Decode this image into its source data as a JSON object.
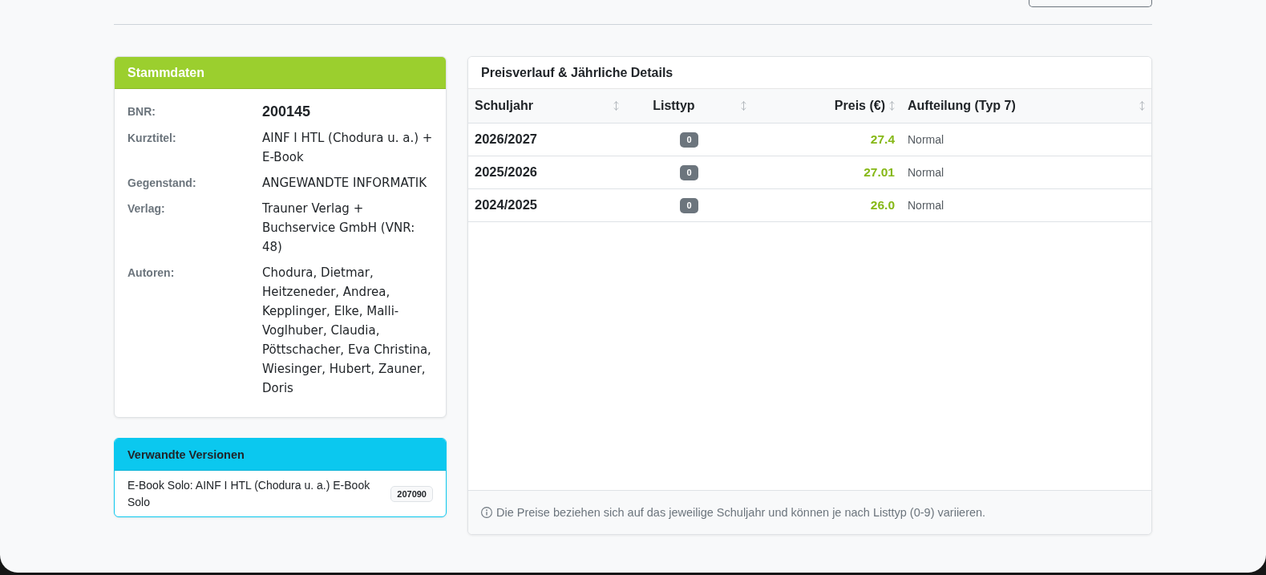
{
  "stammdaten": {
    "title": "Stammdaten",
    "fields": [
      {
        "label": "BNR:",
        "value": "200145",
        "kind": "emphasis"
      },
      {
        "label": "Kurztitel:",
        "value": "AINF I HTL (Chodura u. a.) + E-Book",
        "kind": "plain"
      },
      {
        "label": "Gegenstand:",
        "value": "ANGEWANDTE INFORMATIK",
        "kind": "plain"
      },
      {
        "label": "Verlag:",
        "value": "Trauner Verlag + Buchservice GmbH (VNR: 48)",
        "kind": "plain"
      },
      {
        "label": "Autoren:",
        "value": "Chodura, Dietmar, Heitzeneder, Andrea, Kepplinger, Elke, Malli-Voglhuber, Claudia, Pöttschacher, Eva Christina, Wiesinger, Hubert, Zauner, Doris",
        "kind": "plain"
      }
    ]
  },
  "verwandte_versionen": {
    "title": "Verwandte Versionen",
    "items": [
      {
        "text": "E-Book Solo: AINF I HTL (Chodura u. a.) E-Book Solo",
        "bnr": "207090"
      }
    ]
  },
  "preisverlauf": {
    "title": "Preisverlauf & Jährliche Details",
    "columns": [
      "Schuljahr",
      "Listtyp",
      "Preis (€)",
      "Aufteilung (Typ 7)"
    ],
    "rows": [
      {
        "schuljahr": "2026/2027",
        "listtyp": "0",
        "preis": "27.4",
        "aufteilung": "Normal"
      },
      {
        "schuljahr": "2025/2026",
        "listtyp": "0",
        "preis": "27.01",
        "aufteilung": "Normal"
      },
      {
        "schuljahr": "2024/2025",
        "listtyp": "0",
        "preis": "26.0",
        "aufteilung": "Normal"
      }
    ],
    "footer": "Die Preise beziehen sich auf das jeweilige Schuljahr und können je nach Listtyp (0-9) variieren."
  }
}
